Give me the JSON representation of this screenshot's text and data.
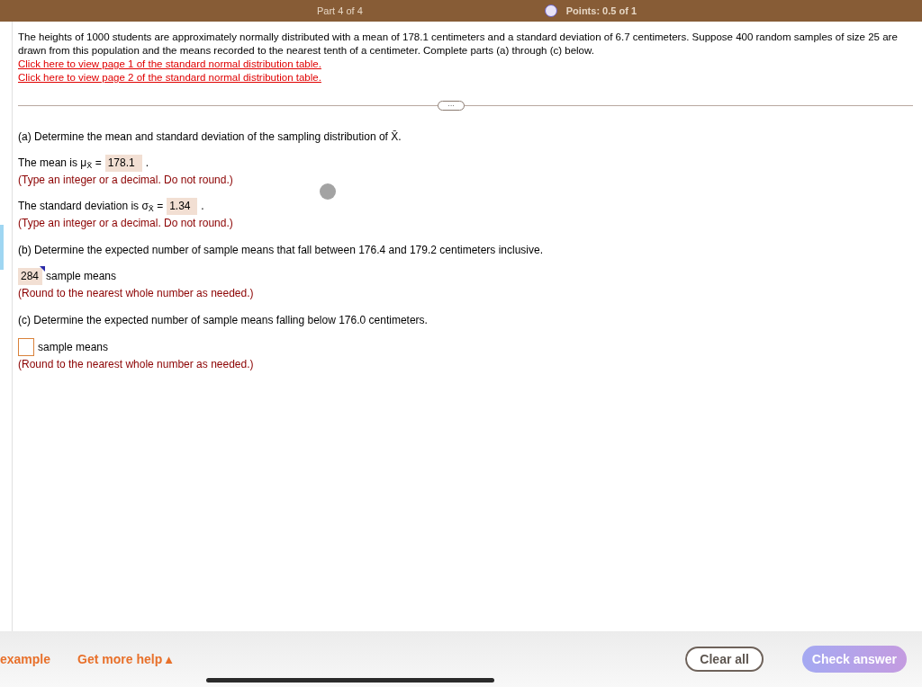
{
  "top_bar": {
    "part": "Part 4 of 4",
    "points": "Points: 0.5 of 1"
  },
  "problem": {
    "text": "The heights of 1000 students are approximately normally distributed with a mean of 178.1 centimeters and a standard deviation of 6.7 centimeters. Suppose 400 random samples of size 25 are drawn from this population and the means recorded to the nearest tenth of a centimeter. Complete parts (a) through (c) below.",
    "links": [
      "Click here to view page 1 of the standard normal distribution table.",
      "Click here to view page 2 of the standard normal distribution table."
    ]
  },
  "expand_button": "···",
  "parts": [
    {
      "kind": "heading",
      "text": "(a) Determine the mean and standard deviation of the sampling distribution of X̄."
    },
    {
      "kind": "answer",
      "before": "The mean is μ$_{X̄}$ =",
      "value": "178.1",
      "after": ".",
      "flagged": false
    },
    {
      "kind": "hint",
      "text": "(Type an integer or a decimal. Do not round.)"
    },
    {
      "kind": "answer",
      "before": "The standard deviation is σ$_{X̄}$ =",
      "value": "1.34",
      "after": ".",
      "flagged": false
    },
    {
      "kind": "hint",
      "text": "(Type an integer or a decimal. Do not round.)"
    },
    {
      "kind": "heading",
      "text": "(b) Determine the expected number of sample means that fall between 176.4 and 179.2 centimeters inclusive."
    },
    {
      "kind": "answer",
      "value": "284",
      "after": "sample means",
      "flagged": true
    },
    {
      "kind": "hint",
      "text": "(Round to the nearest whole number as needed.)"
    },
    {
      "kind": "heading",
      "text": "(c) Determine the expected number of sample means falling below 176.0 centimeters."
    },
    {
      "kind": "answer",
      "after": "sample means",
      "flagged": false
    },
    {
      "kind": "hint",
      "text": "(Round to the nearest whole number as needed.)"
    }
  ],
  "footer": {
    "example": "example",
    "help": "Get more help ▴",
    "clear": "Clear all",
    "check": "Check answer"
  }
}
